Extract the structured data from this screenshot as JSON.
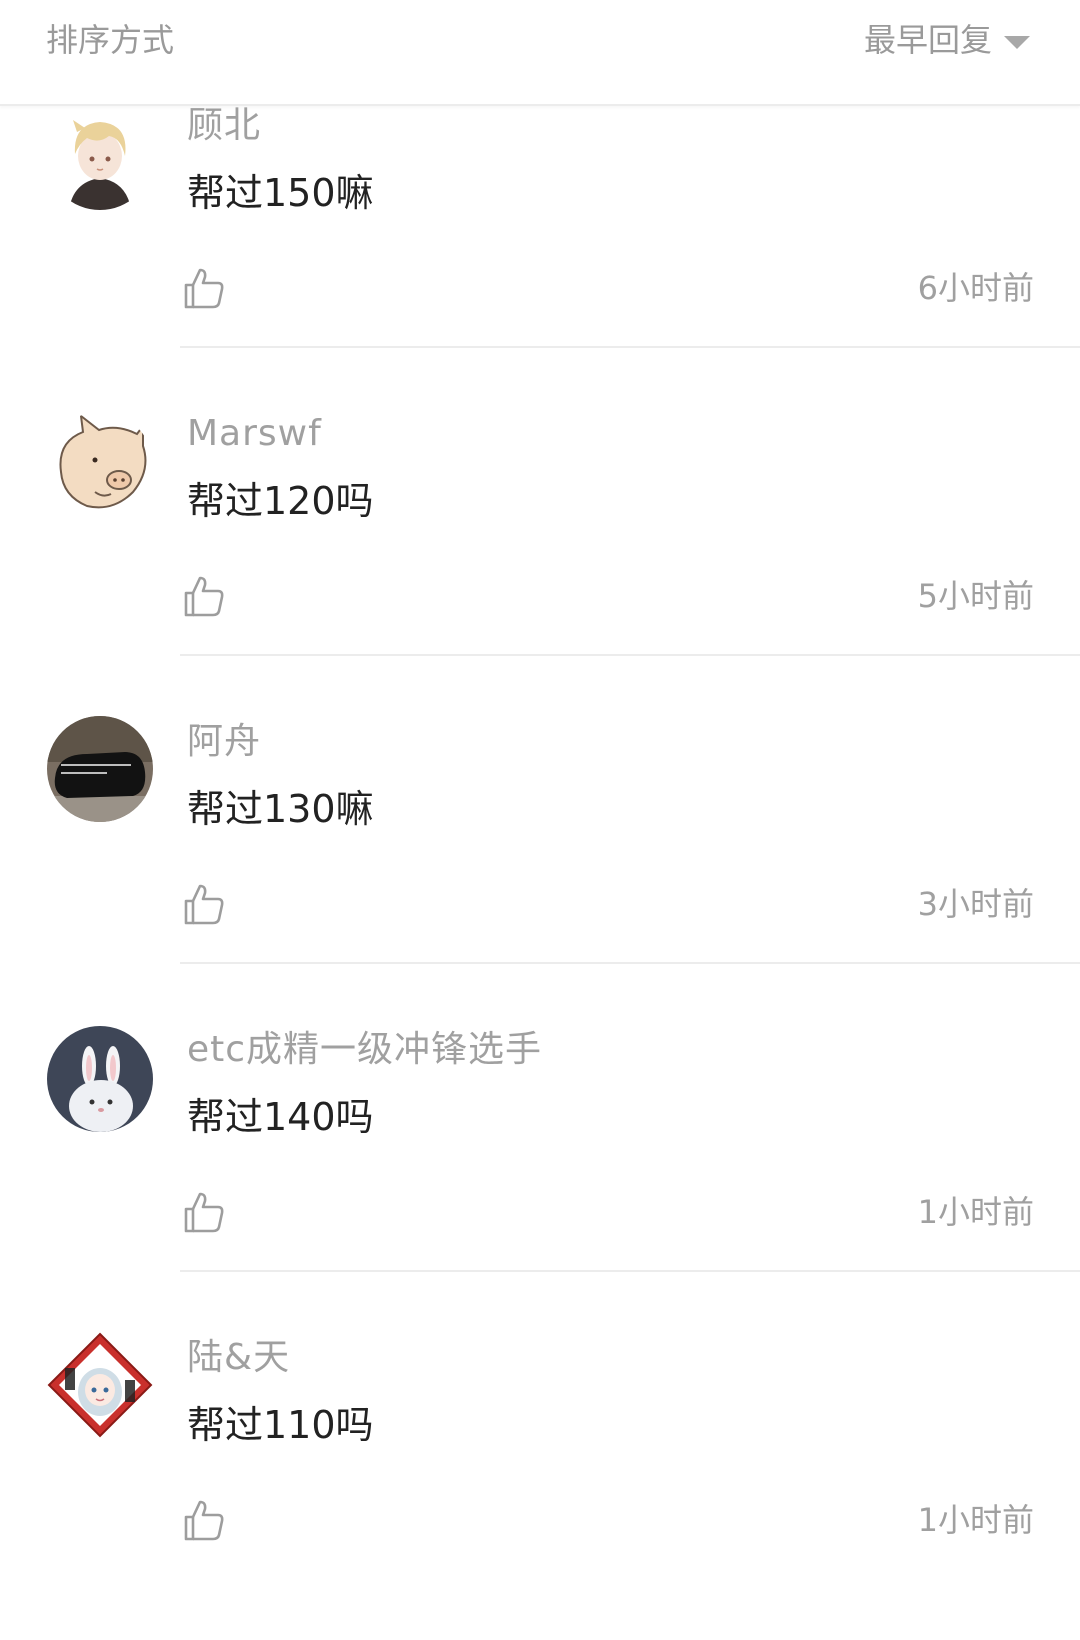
{
  "header": {
    "sort_label": "排序方式",
    "sort_value": "最早回复"
  },
  "comments": [
    {
      "username": "顾北",
      "content": "帮过150嘛",
      "time": "6小时前",
      "avatar": "blonde-boy-avatar"
    },
    {
      "username": "Marswf",
      "content": "帮过120吗",
      "time": "5小时前",
      "avatar": "pig-avatar"
    },
    {
      "username": "阿舟",
      "content": "帮过130嘛",
      "time": "3小时前",
      "avatar": "black-bear-avatar"
    },
    {
      "username": "etc成精一级冲锋选手",
      "content": "帮过140吗",
      "time": "1小时前",
      "avatar": "white-rabbit-avatar"
    },
    {
      "username": "陆&天",
      "content": "帮过110吗",
      "time": "1小时前",
      "avatar": "anime-girl-avatar"
    }
  ],
  "colors": {
    "text_primary": "#222222",
    "text_secondary": "#a0a0a0",
    "divider": "#ececec"
  }
}
